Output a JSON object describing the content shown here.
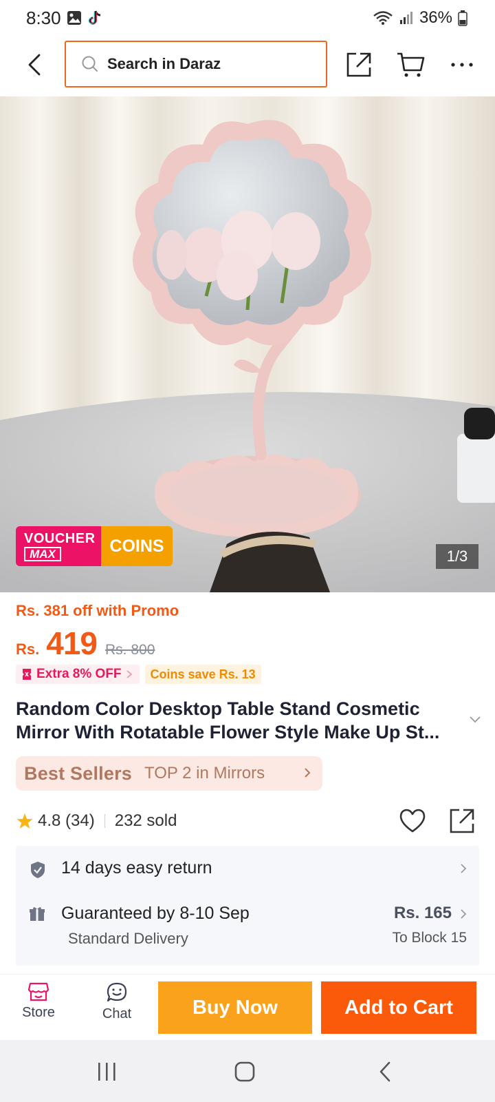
{
  "status_bar": {
    "time": "8:30",
    "battery": "36%"
  },
  "header": {
    "search_placeholder": "Search in Daraz"
  },
  "gallery": {
    "counter": "1/3",
    "badge": {
      "voucher_line1": "VOUCHER",
      "voucher_line2": "MAX",
      "coins": "COINS"
    }
  },
  "price": {
    "promo_text": "Rs. 381 off with Promo",
    "currency": "Rs.",
    "current": "419",
    "original": "Rs. 800"
  },
  "tags": {
    "extra_off": "Extra 8% OFF",
    "coins_save": "Coins save Rs. 13"
  },
  "product": {
    "title": "Random Color Desktop Table Stand Cosmetic Mirror With Rotatable Flower Style Make Up St..."
  },
  "best_sellers": {
    "logo": "Best Sellers",
    "rank": "TOP 2 in Mirrors"
  },
  "rating": {
    "value": "4.8 (34)",
    "sold": "232 sold"
  },
  "service": {
    "return_label": "14 days easy return",
    "delivery_label": "Guaranteed by 8-10 Sep",
    "delivery_type": "Standard Delivery",
    "delivery_price": "Rs. 165",
    "delivery_location": "To Block 15"
  },
  "bottom_bar": {
    "store": "Store",
    "chat": "Chat",
    "buy_now": "Buy Now",
    "add_to_cart": "Add to Cart"
  },
  "colors": {
    "accent": "#f05a16",
    "buy_now": "#fba21d",
    "add_to_cart": "#fa5a0a",
    "voucher_pink": "#ec1366",
    "coins_orange": "#f4a100"
  },
  "icons": {
    "back": "back-arrow-icon",
    "search": "search-icon",
    "share": "share-icon",
    "cart": "cart-icon",
    "more": "more-icon",
    "star": "star-icon",
    "heart": "heart-icon",
    "shield": "shield-icon",
    "gift": "gift-icon",
    "store": "store-icon",
    "chat": "chat-icon"
  }
}
